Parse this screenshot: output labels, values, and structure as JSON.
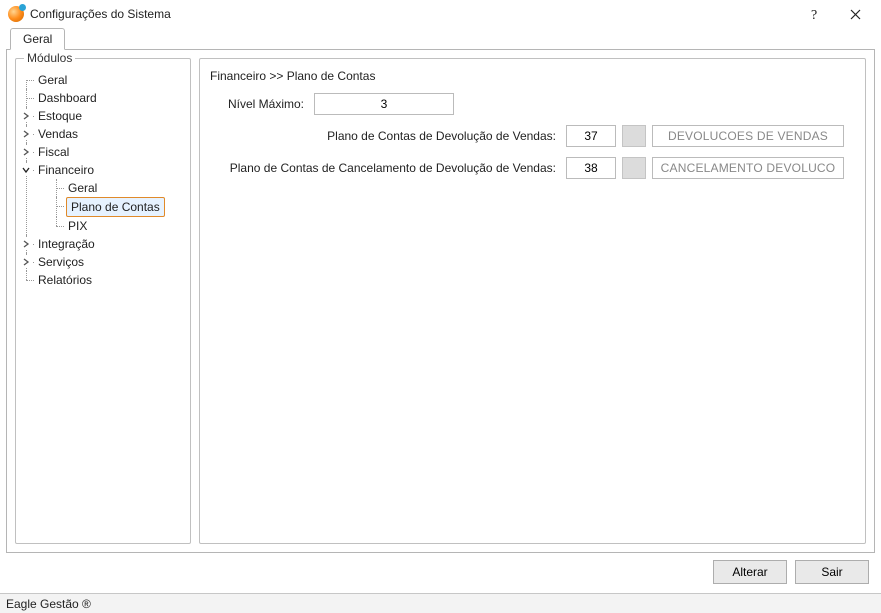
{
  "window": {
    "title": "Configurações do Sistema"
  },
  "tabs": {
    "main": "Geral"
  },
  "modules": {
    "legend": "Módulos",
    "items": [
      {
        "label": "Geral",
        "expandable": false
      },
      {
        "label": "Dashboard",
        "expandable": false
      },
      {
        "label": "Estoque",
        "expandable": true,
        "expanded": false
      },
      {
        "label": "Vendas",
        "expandable": true,
        "expanded": false
      },
      {
        "label": "Fiscal",
        "expandable": true,
        "expanded": false
      },
      {
        "label": "Financeiro",
        "expandable": true,
        "expanded": true,
        "children": [
          {
            "label": "Geral"
          },
          {
            "label": "Plano de Contas",
            "selected": true
          },
          {
            "label": "PIX"
          }
        ]
      },
      {
        "label": "Integração",
        "expandable": true,
        "expanded": false
      },
      {
        "label": "Serviços",
        "expandable": true,
        "expanded": false
      },
      {
        "label": "Relatórios",
        "expandable": false
      }
    ]
  },
  "panel": {
    "breadcrumb": "Financeiro >> Plano de Contas",
    "fields": {
      "nivel_label": "Nível Máximo:",
      "nivel_value": "3",
      "devolucao_label": "Plano de Contas de Devolução de Vendas:",
      "devolucao_code": "37",
      "devolucao_desc": "DEVOLUCOES DE VENDAS",
      "cancelamento_label": "Plano de Contas de Cancelamento de Devolução de Vendas:",
      "cancelamento_code": "38",
      "cancelamento_desc": "CANCELAMENTO DEVOLUCO"
    }
  },
  "buttons": {
    "alterar": "Alterar",
    "sair": "Sair"
  },
  "statusbar": "Eagle Gestão ®"
}
